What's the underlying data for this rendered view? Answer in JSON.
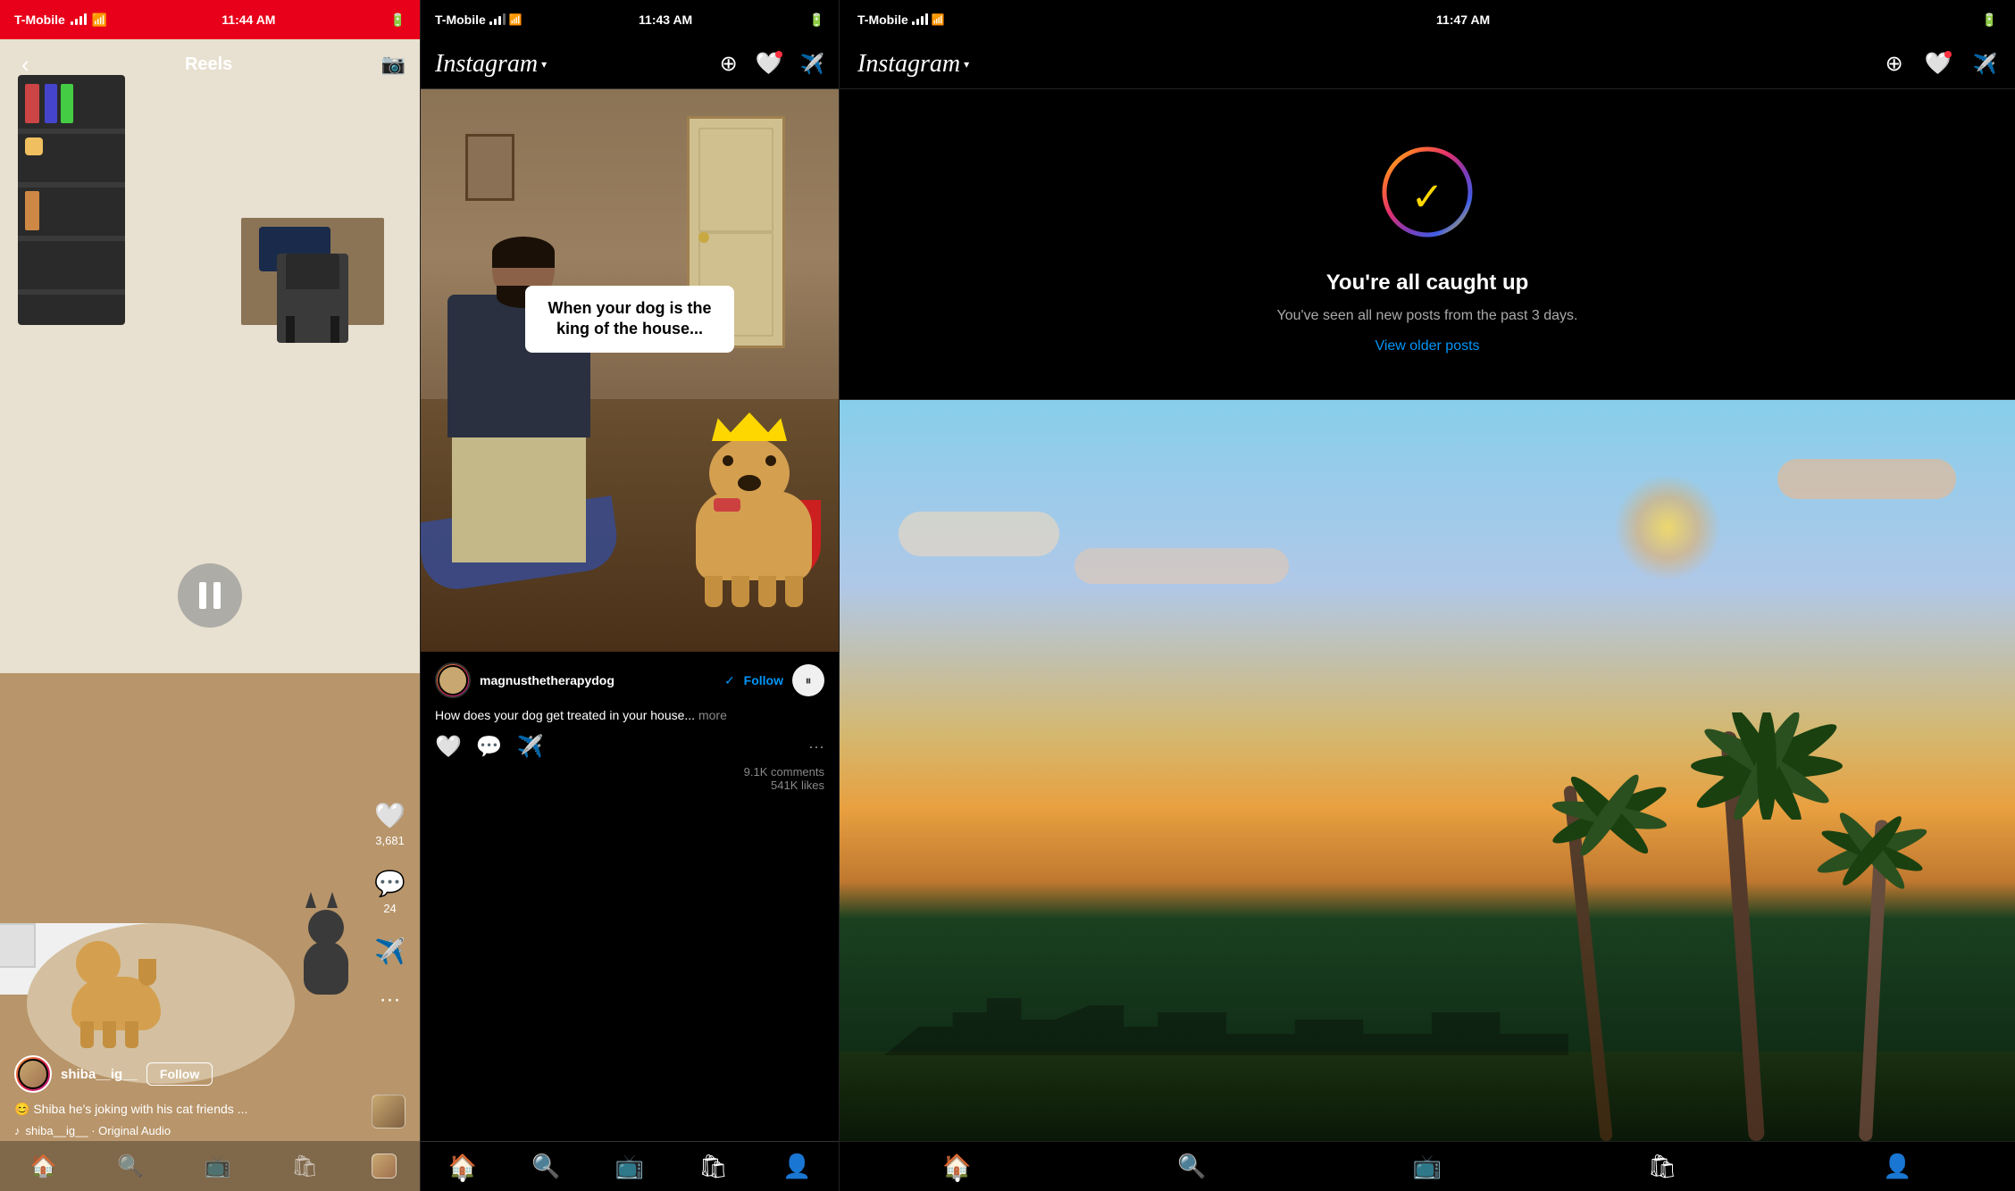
{
  "panel1": {
    "status": {
      "carrier": "T-Mobile",
      "time": "11:44 AM",
      "battery": "●●●●"
    },
    "title": "Reels",
    "camera_icon": "📷",
    "like_count": "3,681",
    "comment_count": "24",
    "username": "shiba__ig__",
    "follow_label": "Follow",
    "caption": "😊 Shiba he's joking with his cat friends ...",
    "audio": "shiba__ig__  · Original Audio",
    "nav": {
      "home": "🏠",
      "search": "🔍",
      "reels": "🎬",
      "shop": "🛍",
      "profile": "👤"
    }
  },
  "panel2": {
    "status": {
      "carrier": "T-Mobile",
      "time": "11:43 AM"
    },
    "logo": "Instagram",
    "username": "magnusthetherapydog",
    "follow_label": "Follow",
    "caption": "How does your dog get treated in your house...",
    "caption_more": "more",
    "caption_video": "When your dog is the king of the house...",
    "comments": "9.1K comments",
    "likes": "541K likes",
    "nav": {
      "home": "🏠",
      "search": "🔍",
      "reels": "🎬",
      "shop": "🛍",
      "profile": "👤"
    }
  },
  "panel3": {
    "status": {
      "carrier": "T-Mobile",
      "time": "11:47 AM"
    },
    "logo": "Instagram",
    "caught_up_title": "You're all caught up",
    "caught_up_subtitle": "You've seen all new posts from the past 3 days.",
    "view_older_label": "View older posts",
    "nav": {
      "home": "🏠",
      "search": "🔍",
      "reels": "🎬",
      "shop": "🛍",
      "profile": "👤"
    }
  }
}
